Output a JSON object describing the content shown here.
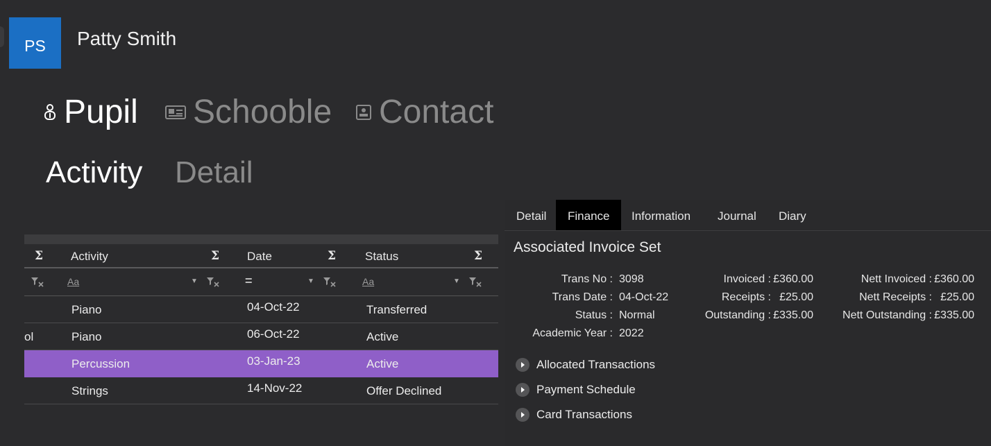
{
  "user": {
    "initials": "PS",
    "name": "Patty Smith"
  },
  "modules": [
    {
      "label": "Pupil",
      "icon": "pupil-icon",
      "active": true
    },
    {
      "label": "Schooble",
      "icon": "id-card-icon",
      "active": false
    },
    {
      "label": "Contact",
      "icon": "contact-card-icon",
      "active": false
    }
  ],
  "views": [
    {
      "label": "Activity",
      "active": true
    },
    {
      "label": "Detail",
      "active": false
    }
  ],
  "grid": {
    "columns": [
      "Activity",
      "Date",
      "Status"
    ],
    "sigma": "Σ",
    "filter_text": "Aa",
    "filter_equals": "=",
    "rows": [
      {
        "col0": "",
        "activity": "Piano",
        "date": "04-Oct-22",
        "status": "Transferred",
        "selected": false
      },
      {
        "col0": "ol",
        "activity": "Piano",
        "date": "06-Oct-22",
        "status": "Active",
        "selected": false
      },
      {
        "col0": "",
        "activity": "Percussion",
        "date": "03-Jan-23",
        "status": "Active",
        "selected": true
      },
      {
        "col0": "",
        "activity": "Strings",
        "date": "14-Nov-22",
        "status": "Offer Declined",
        "selected": false
      }
    ],
    "selected_color": "#8f5fc8"
  },
  "panel": {
    "tabs": [
      "Detail",
      "Finance",
      "Information",
      "Journal",
      "Diary"
    ],
    "active_tab": "Finance",
    "section_title": "Associated Invoice Set",
    "fields": {
      "trans_no": {
        "label": "Trans No :",
        "value": "3098"
      },
      "trans_date": {
        "label": "Trans Date :",
        "value": "04-Oct-22"
      },
      "status": {
        "label": "Status :",
        "value": "Normal"
      },
      "academic_year": {
        "label": "Academic Year :",
        "value": "2022"
      },
      "invoiced": {
        "label": "Invoiced :",
        "value": "£360.00"
      },
      "receipts": {
        "label": "Receipts :",
        "value": "£25.00"
      },
      "outstanding": {
        "label": "Outstanding :",
        "value": "£335.00"
      },
      "nett_invoiced": {
        "label": "Nett Invoiced :",
        "value": "£360.00"
      },
      "nett_receipts": {
        "label": "Nett Receipts :",
        "value": "£25.00"
      },
      "nett_outstanding": {
        "label": "Nett Outstanding :",
        "value": "£335.00"
      }
    },
    "expanders": [
      "Allocated Transactions",
      "Payment Schedule",
      "Card Transactions"
    ]
  },
  "colors": {
    "accent_blue": "#1b6fc4",
    "background": "#2b2b2d"
  }
}
